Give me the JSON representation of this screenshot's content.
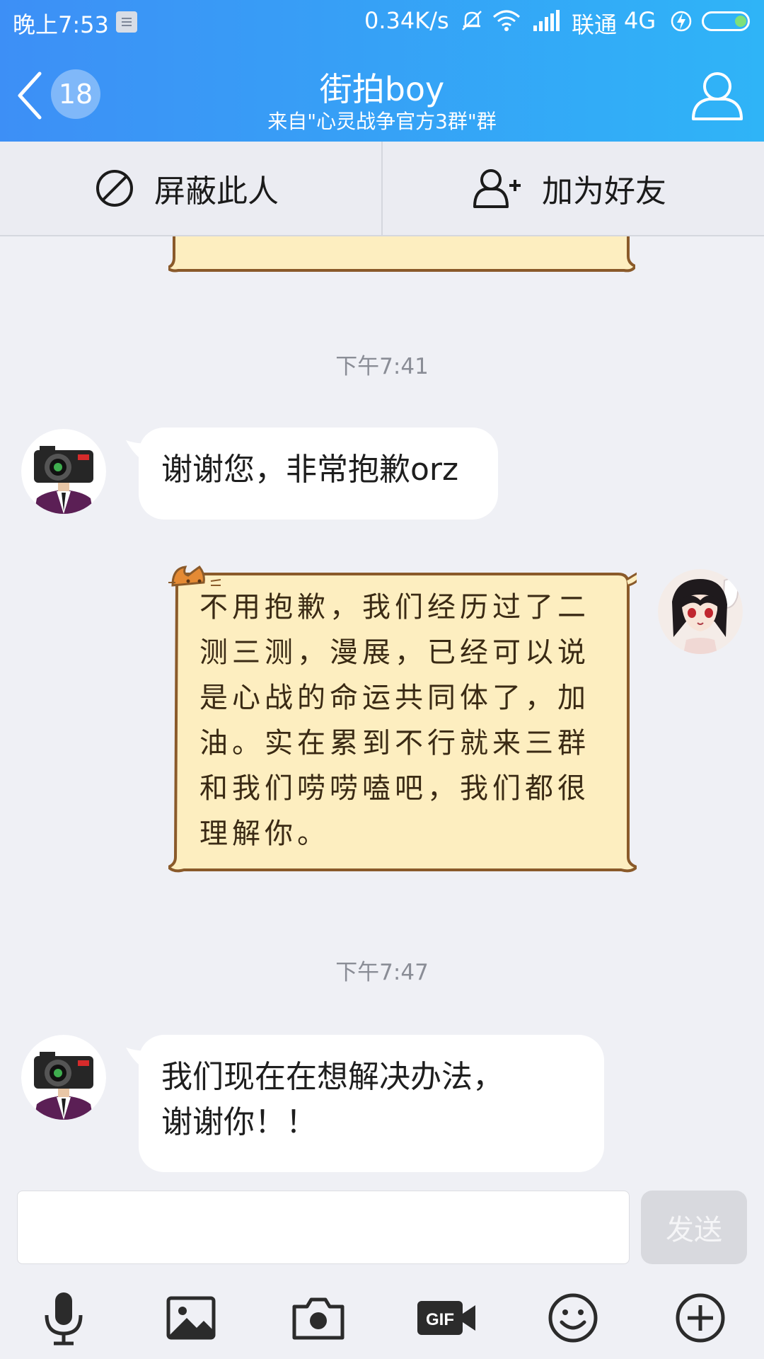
{
  "status": {
    "time": "晚上7:53",
    "speed": "0.34K/s",
    "carrier": "联通",
    "network": "4G"
  },
  "header": {
    "unread_count": "18",
    "title": "街拍boy",
    "subtitle": "来自\"心灵战争官方3群\"群"
  },
  "actions": {
    "block_label": "屏蔽此人",
    "add_friend_label": "加为好友"
  },
  "messages": [
    {
      "type": "timestamp",
      "text": "下午7:41"
    },
    {
      "type": "incoming",
      "text": "谢谢您，非常抱歉orz"
    },
    {
      "type": "outgoing",
      "text": "不用抱歉，我们经历过了二测三测，漫展，已经可以说是心战的命运共同体了，加油。实在累到不行就来三群和我们唠唠嗑吧，我们都很理解你。"
    },
    {
      "type": "timestamp",
      "text": "下午7:47"
    },
    {
      "type": "incoming",
      "text_line1": "我们现在在想解决办法，",
      "text_line2": "谢谢你！！"
    }
  ],
  "input": {
    "send_label": "发送"
  },
  "toolbar": {
    "icons": [
      "microphone-icon",
      "image-icon",
      "camera-icon",
      "gif-icon",
      "emoji-icon",
      "plus-icon"
    ]
  },
  "colors": {
    "header_gradient_start": "#3d8ff6",
    "header_gradient_end": "#2fb4f7",
    "note_fill": "#fdeec0",
    "note_border": "#8a5a2a"
  }
}
